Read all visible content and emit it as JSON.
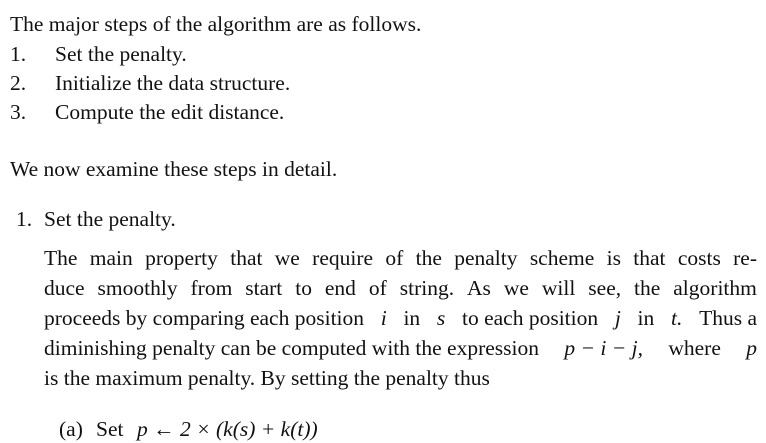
{
  "intro": {
    "text": "The major steps of the algorithm are as follows."
  },
  "steps": [
    {
      "num": "1.",
      "text": "Set the penalty."
    },
    {
      "num": "2.",
      "text": "Initialize the data structure."
    },
    {
      "num": "3.",
      "text": "Compute the edit distance."
    }
  ],
  "detail_intro": "We now examine these steps in detail.",
  "section": {
    "num": "1.",
    "title": "Set the penalty."
  },
  "paragraph": {
    "line1_words": [
      "The",
      "main",
      "property",
      "that",
      "we",
      "require",
      "of",
      "the",
      "penalty",
      "scheme",
      "is",
      "that",
      "costs",
      "re-"
    ],
    "line2_words": [
      "duce",
      "smoothly",
      "from",
      "start",
      "to",
      "end",
      "of",
      "string.",
      "As",
      "we",
      "will",
      "see,",
      "the",
      "algorithm"
    ],
    "line3": {
      "a": "proceeds by comparing each position",
      "i": "i",
      "b": "in",
      "s": "s",
      "c": "to each position",
      "j": "j",
      "d": "in",
      "t": "t.",
      "e": "Thus a"
    },
    "line4": {
      "a": "diminishing penalty can be computed with the expression",
      "expr": "p − i − j,",
      "b": "where",
      "p": "p"
    },
    "line5": "is the maximum penalty. By setting the penalty thus"
  },
  "substep": {
    "label": "(a)",
    "text": "Set",
    "formula": "p ← 2 × (k(s) + k(t))"
  }
}
